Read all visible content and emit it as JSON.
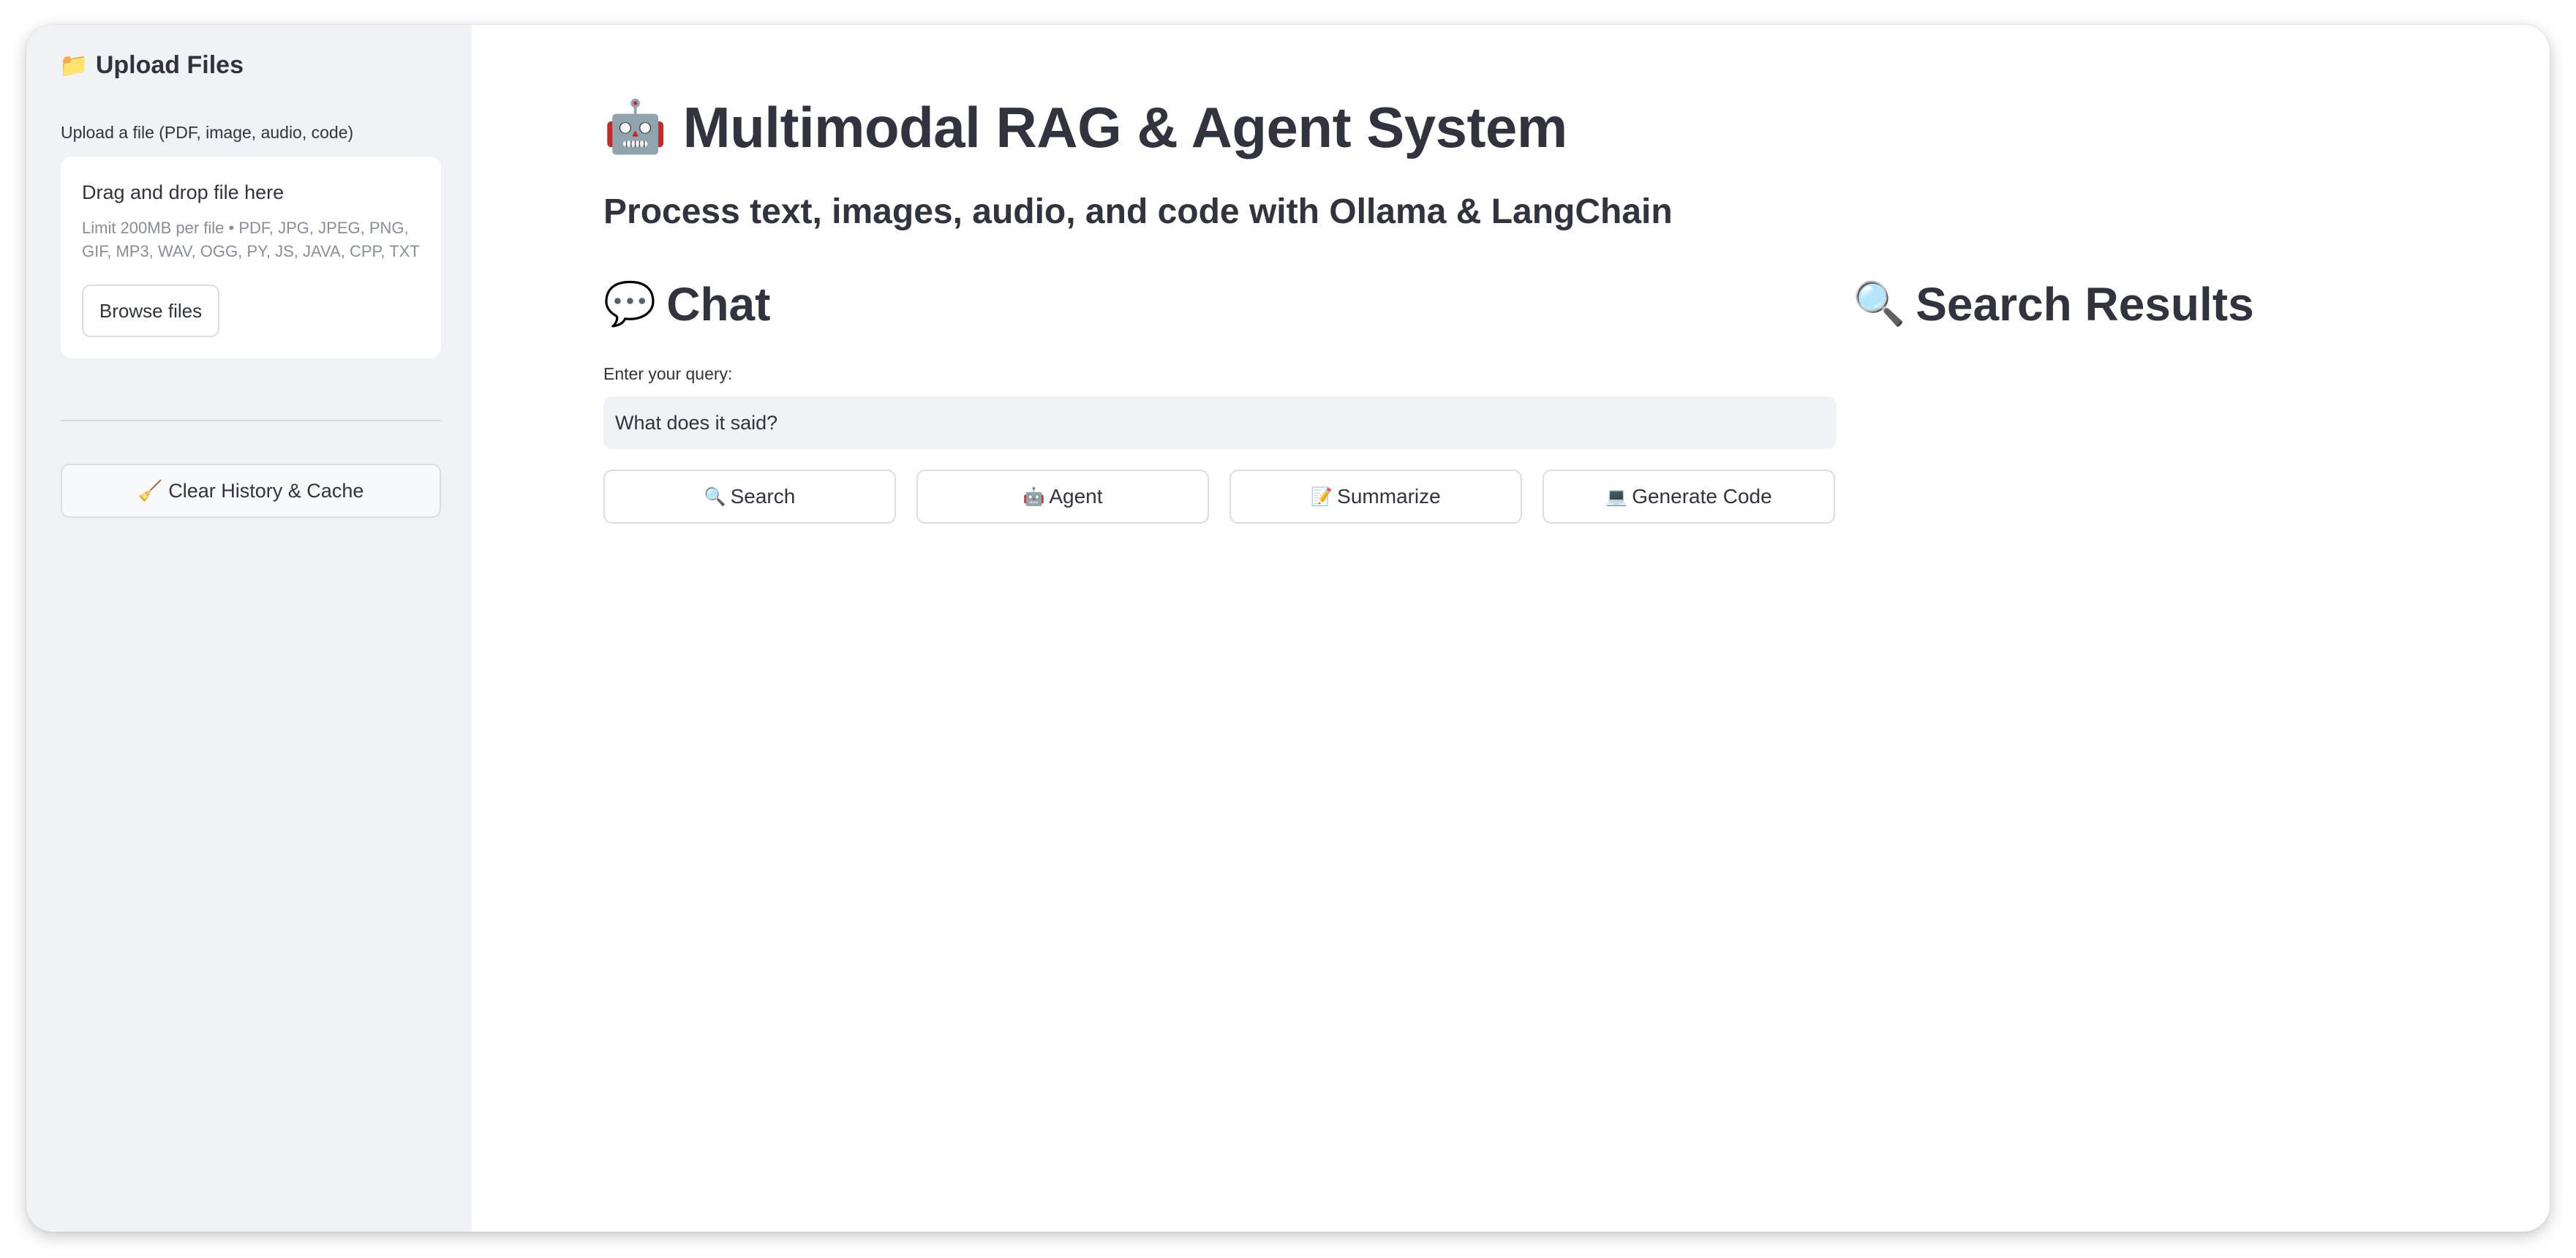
{
  "sidebar": {
    "title": "Upload Files",
    "title_icon": "folder-icon",
    "title_icon_glyph": "📁",
    "upload_label": "Upload a file (PDF, image, audio, code)",
    "dropzone": {
      "title": "Drag and drop file here",
      "limit": "Limit 200MB per file • PDF, JPG, JPEG, PNG, GIF, MP3, WAV, OGG, PY, JS, JAVA, CPP, TXT",
      "browse_label": "Browse files"
    },
    "clear_button": {
      "icon": "broom-icon",
      "icon_glyph": "🧹",
      "label": "Clear History & Cache"
    }
  },
  "main": {
    "title": "Multimodal RAG & Agent System",
    "title_icon": "robot-icon",
    "title_icon_glyph": "🤖",
    "subtitle": "Process text, images, audio, and code with Ollama & LangChain",
    "chat": {
      "heading": "Chat",
      "icon": "speech-bubble-icon",
      "icon_glyph": "💬",
      "query_label": "Enter your query:",
      "query_value": "What does it said?"
    },
    "results": {
      "heading": "Search Results",
      "icon": "magnifier-icon",
      "icon_glyph": "🔍"
    },
    "actions": [
      {
        "label": "Search",
        "icon": "magnifier-icon",
        "icon_glyph": "🔍"
      },
      {
        "label": "Agent",
        "icon": "robot-icon",
        "icon_glyph": "🤖"
      },
      {
        "label": "Summarize",
        "icon": "memo-icon",
        "icon_glyph": "📝"
      },
      {
        "label": "Generate Code",
        "icon": "laptop-icon",
        "icon_glyph": "💻"
      }
    ]
  },
  "colors": {
    "sidebar_bg": "#f0f2f6",
    "text": "#31333f",
    "muted_text": "#8a8d96",
    "border": "#dcdde3"
  }
}
